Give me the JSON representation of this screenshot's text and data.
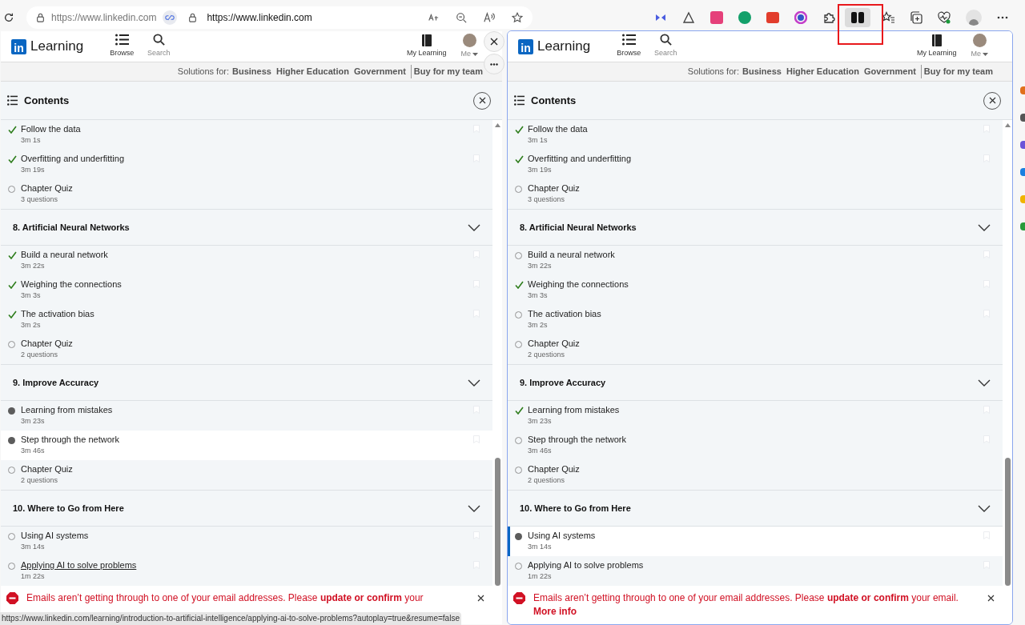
{
  "browser": {
    "site_info_url": "https://www.linkedin.com",
    "url": "https://www.linkedin.com"
  },
  "panes": [
    {
      "focused": false,
      "side_controls": true,
      "logo_mark": "in",
      "brand": "Learning",
      "nav": [
        "Browse",
        "Search"
      ],
      "account": [
        "My Learning",
        "Me"
      ],
      "solutions_prefix": "Solutions for:",
      "solutions": [
        "Business",
        "Higher Education",
        "Government",
        "Buy for my team"
      ],
      "contents_title": "Contents",
      "sections": [
        {
          "items": [
            {
              "kind": "video",
              "title": "Follow the data",
              "meta": "3m 1s",
              "completed": true,
              "in_progress": false,
              "selected": false,
              "current": false,
              "hovered": false
            },
            {
              "kind": "video",
              "title": "Overfitting and underfitting",
              "meta": "3m 19s",
              "completed": true,
              "in_progress": false,
              "selected": false,
              "current": false,
              "hovered": false
            },
            {
              "kind": "quiz",
              "title": "Chapter Quiz",
              "meta": "3 questions",
              "completed": false,
              "in_progress": false,
              "selected": false,
              "current": false,
              "hovered": false
            }
          ]
        },
        {
          "title": "8. Artificial Neural Networks",
          "items": [
            {
              "kind": "video",
              "title": "Build a neural network",
              "meta": "3m 22s",
              "completed": true,
              "in_progress": false,
              "selected": false,
              "current": false,
              "hovered": false
            },
            {
              "kind": "video",
              "title": "Weighing the connections",
              "meta": "3m 3s",
              "completed": true,
              "in_progress": false,
              "selected": false,
              "current": false,
              "hovered": false
            },
            {
              "kind": "video",
              "title": "The activation bias",
              "meta": "3m 2s",
              "completed": true,
              "in_progress": false,
              "selected": false,
              "current": false,
              "hovered": false
            },
            {
              "kind": "quiz",
              "title": "Chapter Quiz",
              "meta": "2 questions",
              "completed": false,
              "in_progress": false,
              "selected": false,
              "current": false,
              "hovered": false
            }
          ]
        },
        {
          "title": "9. Improve Accuracy",
          "items": [
            {
              "kind": "video",
              "title": "Learning from mistakes",
              "meta": "3m 23s",
              "completed": false,
              "in_progress": true,
              "selected": false,
              "current": false,
              "hovered": false
            },
            {
              "kind": "video",
              "title": "Step through the network",
              "meta": "3m 46s",
              "completed": false,
              "in_progress": true,
              "selected": true,
              "current": false,
              "hovered": false
            },
            {
              "kind": "quiz",
              "title": "Chapter Quiz",
              "meta": "2 questions",
              "completed": false,
              "in_progress": false,
              "selected": false,
              "current": false,
              "hovered": false
            }
          ]
        },
        {
          "title": "10. Where to Go from Here",
          "items": [
            {
              "kind": "video",
              "title": "Using AI systems",
              "meta": "3m 14s",
              "completed": false,
              "in_progress": false,
              "selected": false,
              "current": false,
              "hovered": false
            },
            {
              "kind": "video",
              "title": "Applying AI to solve problems",
              "meta": "1m 22s",
              "completed": false,
              "in_progress": false,
              "selected": false,
              "current": false,
              "hovered": true
            }
          ]
        }
      ],
      "banner": "Emails aren’t getting through to one of your email addresses. Please **update or confirm** your",
      "status_url": "https://www.linkedin.com/learning/introduction-to-artificial-intelligence/applying-ai-to-solve-problems?autoplay=true&resume=false"
    },
    {
      "focused": true,
      "side_controls": false,
      "logo_mark": "in",
      "brand": "Learning",
      "nav": [
        "Browse",
        "Search"
      ],
      "account": [
        "My Learning",
        "Me"
      ],
      "solutions_prefix": "Solutions for:",
      "solutions": [
        "Business",
        "Higher Education",
        "Government",
        "Buy for my team"
      ],
      "contents_title": "Contents",
      "sections": [
        {
          "items": [
            {
              "kind": "video",
              "title": "Follow the data",
              "meta": "3m 1s",
              "completed": true,
              "in_progress": false,
              "selected": false,
              "current": false,
              "hovered": false
            },
            {
              "kind": "video",
              "title": "Overfitting and underfitting",
              "meta": "3m 19s",
              "completed": true,
              "in_progress": false,
              "selected": false,
              "current": false,
              "hovered": false
            },
            {
              "kind": "quiz",
              "title": "Chapter Quiz",
              "meta": "3 questions",
              "completed": false,
              "in_progress": false,
              "selected": false,
              "current": false,
              "hovered": false
            }
          ]
        },
        {
          "title": "8. Artificial Neural Networks",
          "items": [
            {
              "kind": "video",
              "title": "Build a neural network",
              "meta": "3m 22s",
              "completed": false,
              "in_progress": false,
              "selected": false,
              "current": false,
              "hovered": false
            },
            {
              "kind": "video",
              "title": "Weighing the connections",
              "meta": "3m 3s",
              "completed": true,
              "in_progress": false,
              "selected": false,
              "current": false,
              "hovered": false
            },
            {
              "kind": "video",
              "title": "The activation bias",
              "meta": "3m 2s",
              "completed": false,
              "in_progress": false,
              "selected": false,
              "current": false,
              "hovered": false
            },
            {
              "kind": "quiz",
              "title": "Chapter Quiz",
              "meta": "2 questions",
              "completed": false,
              "in_progress": false,
              "selected": false,
              "current": false,
              "hovered": false
            }
          ]
        },
        {
          "title": "9. Improve Accuracy",
          "items": [
            {
              "kind": "video",
              "title": "Learning from mistakes",
              "meta": "3m 23s",
              "completed": true,
              "in_progress": false,
              "selected": false,
              "current": false,
              "hovered": false
            },
            {
              "kind": "video",
              "title": "Step through the network",
              "meta": "3m 46s",
              "completed": false,
              "in_progress": false,
              "selected": false,
              "current": false,
              "hovered": false
            },
            {
              "kind": "quiz",
              "title": "Chapter Quiz",
              "meta": "2 questions",
              "completed": false,
              "in_progress": false,
              "selected": false,
              "current": false,
              "hovered": false
            }
          ]
        },
        {
          "title": "10. Where to Go from Here",
          "items": [
            {
              "kind": "video",
              "title": "Using AI systems",
              "meta": "3m 14s",
              "completed": false,
              "in_progress": true,
              "selected": true,
              "current": true,
              "hovered": false
            },
            {
              "kind": "video",
              "title": "Applying AI to solve problems",
              "meta": "1m 22s",
              "completed": false,
              "in_progress": false,
              "selected": false,
              "current": false,
              "hovered": false
            }
          ]
        }
      ],
      "banner": "Emails aren’t getting through to one of your email addresses. Please **update or confirm** your email. **More info**"
    }
  ]
}
